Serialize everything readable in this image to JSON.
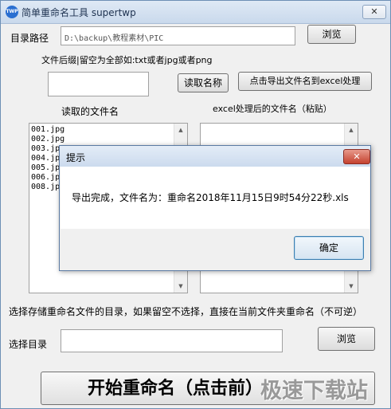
{
  "window": {
    "icon_text": "TWP",
    "title": "简单重命名工具 supertwp",
    "close_label": "✕"
  },
  "dir_path": {
    "label": "目录路径",
    "value": "D:\\backup\\教程素材\\PIC",
    "browse_label": "浏览"
  },
  "suffix": {
    "hint": "文件后缀|留空为全部如:txt或者jpg或者png",
    "value": "",
    "read_label": "读取名称",
    "export_label": "点击导出文件名到excel处理"
  },
  "read_list": {
    "label": "读取的文件名",
    "items": [
      "001.jpg",
      "002.jpg",
      "003.jpg",
      "004.jpg",
      "005.jpg",
      "006.jpg",
      "008.jpg"
    ]
  },
  "excel_list": {
    "label": "excel处理后的文件名（粘贴）"
  },
  "scroll": {
    "up": "▲",
    "down": "▼"
  },
  "save_dir": {
    "hint": "选择存储重命名文件的目录，如果留空不选择，直接在当前文件夹重命名（不可逆）",
    "label": "选择目录",
    "value": "",
    "browse_label": "浏览"
  },
  "start_label": "开始重命名（点击前）",
  "watermark": "极速下载站",
  "dialog": {
    "title": "提示",
    "close_label": "✕",
    "message": "导出完成，文件名为：重命名2018年11月15日9时54分22秒.xls",
    "ok_label": "确定"
  }
}
